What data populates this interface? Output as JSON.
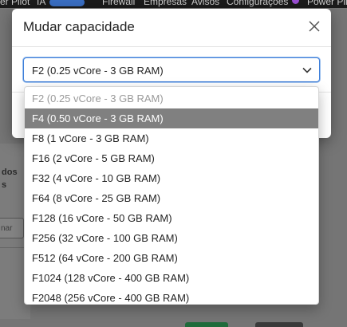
{
  "background": {
    "nav_items": [
      "er Pilot",
      "IA",
      "Firewall",
      "Empresas",
      "Avisos",
      "Configurações",
      "Power Pil"
    ],
    "side_text_1": "dos",
    "side_text_2": "s",
    "filter_placeholder": "nar"
  },
  "dialog": {
    "title": "Mudar capacidade",
    "close_icon": "close-icon"
  },
  "select": {
    "value": "F2 (0.25 vCore - 3 GB RAM)",
    "chevron_icon": "chevron-down-icon"
  },
  "dropdown": {
    "selected_index": 0,
    "highlighted_index": 1,
    "options": [
      "F2 (0.25 vCore - 3 GB RAM)",
      "F4 (0.50 vCore - 3 GB RAM)",
      "F8 (1 vCore - 3 GB RAM)",
      "F16 (2 vCore - 5 GB RAM)",
      "F32 (4 vCore - 10 GB RAM)",
      "F64 (8 vCore - 25 GB RAM)",
      "F128 (16 vCore - 50 GB RAM)",
      "F256 (32 vCore - 100 GB RAM)",
      "F512 (64 vCore - 200 GB RAM)",
      "F1024 (128 vCore - 400 GB RAM)",
      "F2048 (256 vCore - 400 GB RAM)"
    ]
  },
  "colors": {
    "focus_border": "#3f7fd9",
    "highlight_bg": "#808080",
    "overlay": "#757575"
  }
}
